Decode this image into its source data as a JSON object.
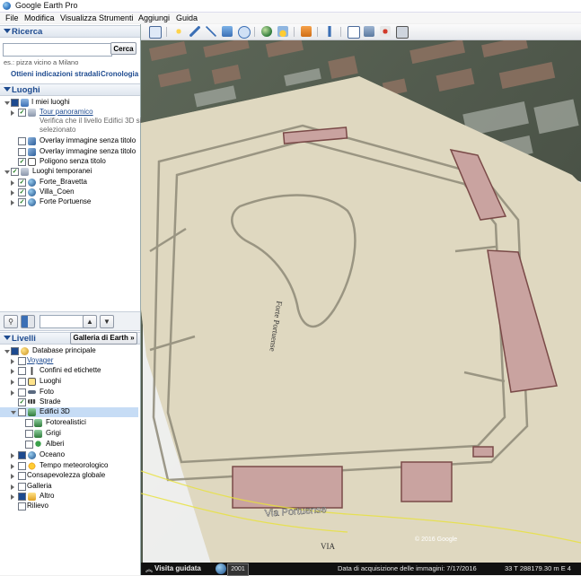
{
  "window": {
    "title": "Google Earth Pro"
  },
  "menu": [
    "File",
    "Modifica",
    "Visualizza",
    "Strumenti",
    "Aggiungi",
    "Guida"
  ],
  "search": {
    "section_label": "Ricerca",
    "value": "",
    "placeholder": "",
    "button_label": "Cerca",
    "hint": "es.: pizza vicino a Milano",
    "directions_link": "Ottieni indicazioni stradali",
    "history_link": "Cronologia"
  },
  "places": {
    "section_label": "Luoghi",
    "items": [
      {
        "label": "I miei luoghi"
      },
      {
        "label": "Tour panoramico"
      },
      {
        "label": "Verifica che il livello Edifici 3D sia"
      },
      {
        "label": "selezionato"
      },
      {
        "label": "Overlay immagine senza titolo"
      },
      {
        "label": "Overlay immagine senza titolo"
      },
      {
        "label": "Poligono senza titolo"
      },
      {
        "label": "Luoghi temporanei"
      },
      {
        "label": "Forte_Bravetta"
      },
      {
        "label": "Villa_Coen"
      },
      {
        "label": "Forte Portuense"
      }
    ]
  },
  "layers": {
    "section_label": "Livelli",
    "gallery_button": "Galleria di Earth",
    "items": [
      {
        "label": "Database principale"
      },
      {
        "label": "Voyager"
      },
      {
        "label": "Confini ed etichette"
      },
      {
        "label": "Luoghi"
      },
      {
        "label": "Foto"
      },
      {
        "label": "Strade"
      },
      {
        "label": "Edifici 3D"
      },
      {
        "label": "Fotorealistici"
      },
      {
        "label": "Grigi"
      },
      {
        "label": "Alberi"
      },
      {
        "label": "Oceano"
      },
      {
        "label": "Tempo meteorologico"
      },
      {
        "label": "Consapevolezza globale"
      },
      {
        "label": "Galleria"
      },
      {
        "label": "Altro"
      },
      {
        "label": "Rilievo"
      }
    ]
  },
  "map": {
    "label_via": "Via Portuense",
    "label_forte": "Forte Portuense",
    "label_via_short": "VIA",
    "copyright": "© 2016 Google"
  },
  "statusbar": {
    "tour_label": "Visita guidata",
    "year": "2001",
    "imagery_date": "Data di acquisizione delle immagini: 7/17/2016",
    "coords": "33 T 288179.30 m E 4"
  }
}
